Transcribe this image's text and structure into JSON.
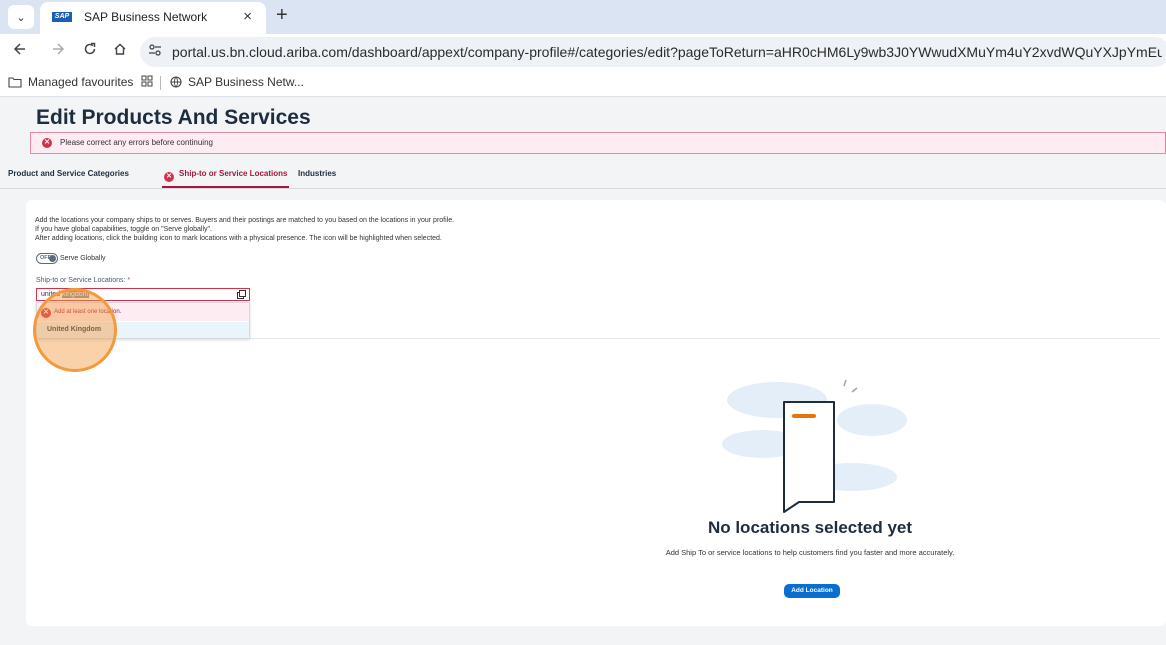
{
  "browser": {
    "tab_title": "SAP Business Network",
    "tab_favicon_text": "SAP",
    "close_glyph": "×",
    "new_tab_glyph": "+",
    "menu_glyph": "⌄",
    "url": "portal.us.bn.cloud.ariba.com/dashboard/appext/company-profile#/categories/edit?pageToReturn=aHR0cHM6Ly9wb3J0YWwudXMuYm4uY2xvdWQuYXJpYmEuY29tL2Rhc2hib2FyZC9hcHBleHQ",
    "bookmarks": {
      "managed": "Managed favourites",
      "sap": "SAP Business Netw..."
    }
  },
  "page": {
    "title": "Edit Products And Services",
    "error_banner": "Please correct any errors before continuing",
    "tabs": [
      {
        "label": "Product and Service Categories"
      },
      {
        "label": "Ship-to or Service Locations"
      },
      {
        "label": "Industries"
      }
    ],
    "description": [
      "Add the locations your company ships to or serves. Buyers and their postings are matched to you based on the locations in your profile.",
      "If you have global capabilities, toggle on \"Serve globally\".",
      "After adding locations, click the building icon to mark locations with a physical presence. The icon will be highlighted when selected."
    ],
    "toggle": {
      "state": "OFF",
      "label": "Serve Globally"
    },
    "location_field": {
      "label": "Ship-to or Service Locations:",
      "required_mark": "*",
      "value_typed": "united ",
      "value_selected": "kingdom",
      "error": "Add at least one location.",
      "suggestion": "United Kingdom"
    },
    "empty_state": {
      "title": "No locations selected yet",
      "text": "Add Ship To or service locations to help customers find you faster and more accurately.",
      "button": "Add Location"
    }
  },
  "colors": {
    "error": "#d0314b",
    "accent": "#0a6ed1",
    "highlight": "#f29a3e"
  }
}
